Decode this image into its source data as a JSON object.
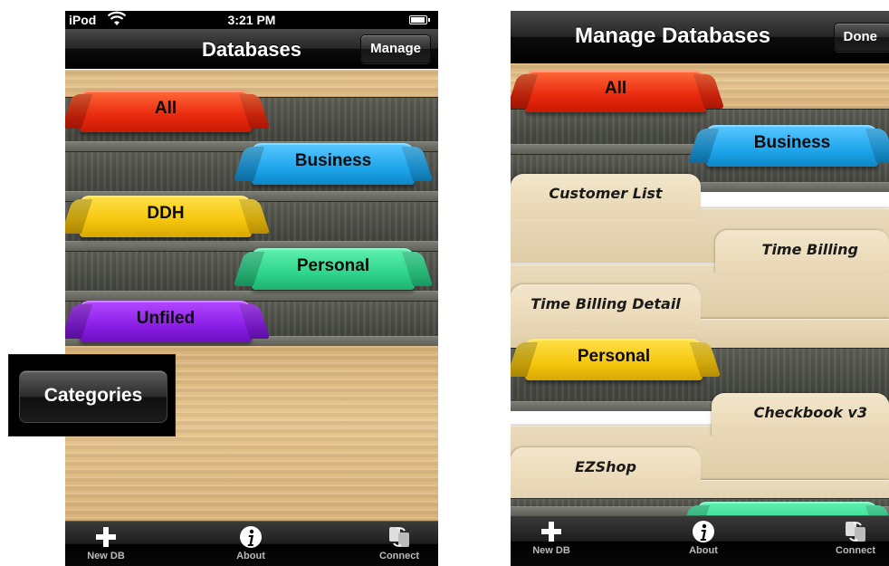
{
  "left_screen": {
    "statusbar": {
      "carrier": "iPod",
      "time": "3:21 PM"
    },
    "title": "Databases",
    "manage_button": "Manage",
    "categories": [
      {
        "label": "All",
        "color": "#e8290d"
      },
      {
        "label": "Business",
        "color": "#1fa6ec"
      },
      {
        "label": "DDH",
        "color": "#f5c60c"
      },
      {
        "label": "Personal",
        "color": "#2fd58c"
      },
      {
        "label": "Unfiled",
        "color": "#8b1ee6"
      }
    ],
    "tabbar": [
      {
        "label": "New DB",
        "icon": "plus-icon"
      },
      {
        "label": "About",
        "icon": "info-icon"
      },
      {
        "label": "Connect",
        "icon": "connect-icon"
      }
    ]
  },
  "categories_callout": {
    "label": "Categories"
  },
  "right_screen": {
    "title": "Manage Databases",
    "done_button": "Done",
    "categories": [
      {
        "label": "All",
        "color": "#e8290d"
      },
      {
        "label": "Business",
        "color": "#1fa6ec"
      },
      {
        "label": "Personal",
        "color": "#f5c60c"
      }
    ],
    "databases": [
      "Customer List",
      "Time Billing",
      "Time Billing Detail",
      "Checkbook v3",
      "EZShop"
    ],
    "tabbar": [
      {
        "label": "New DB",
        "icon": "plus-icon"
      },
      {
        "label": "About",
        "icon": "info-icon"
      },
      {
        "label": "Connect",
        "icon": "connect-icon"
      }
    ]
  }
}
